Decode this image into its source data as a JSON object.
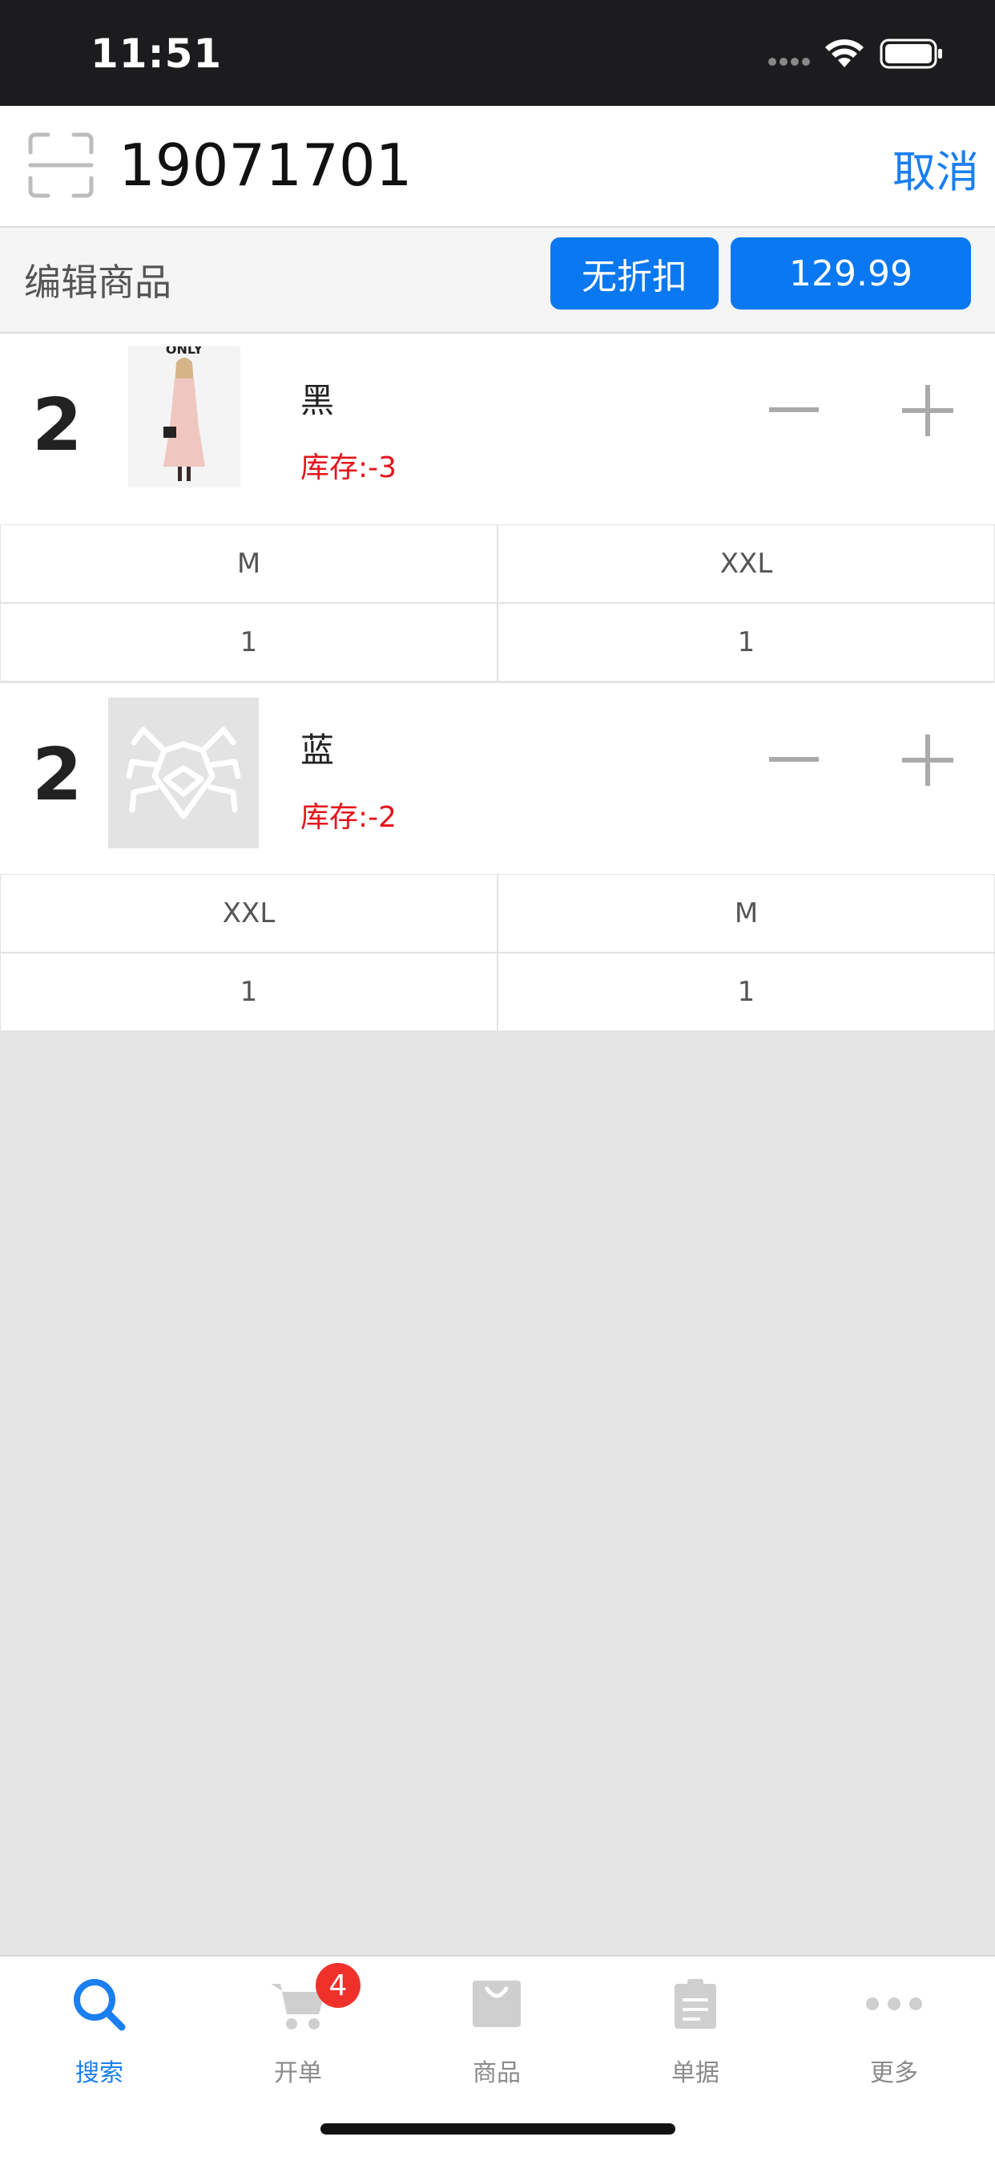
{
  "status": {
    "time": "11:51"
  },
  "header": {
    "search_value": "19071701",
    "cancel_label": "取消"
  },
  "edit": {
    "label": "编辑商品",
    "discount_label": "无折扣",
    "price": "129.99"
  },
  "products": [
    {
      "quantity": "2",
      "color": "黑",
      "stock": "库存:-3",
      "image_text": "ONLY",
      "sizes": [
        {
          "size": "M",
          "qty": "1"
        },
        {
          "size": "XXL",
          "qty": "1"
        }
      ]
    },
    {
      "quantity": "2",
      "color": "蓝",
      "stock": "库存:-2",
      "sizes": [
        {
          "size": "XXL",
          "qty": "1"
        },
        {
          "size": "M",
          "qty": "1"
        }
      ]
    }
  ],
  "tabbar": {
    "items": [
      {
        "label": "搜索",
        "icon": "search-icon"
      },
      {
        "label": "开单",
        "icon": "cart-icon",
        "badge": "4"
      },
      {
        "label": "商品",
        "icon": "bag-icon"
      },
      {
        "label": "单据",
        "icon": "clipboard-icon"
      },
      {
        "label": "更多",
        "icon": "more-icon"
      }
    ]
  },
  "colors": {
    "accent": "#0a78f0",
    "danger": "#e5141b",
    "background": "#e5e5e5"
  }
}
